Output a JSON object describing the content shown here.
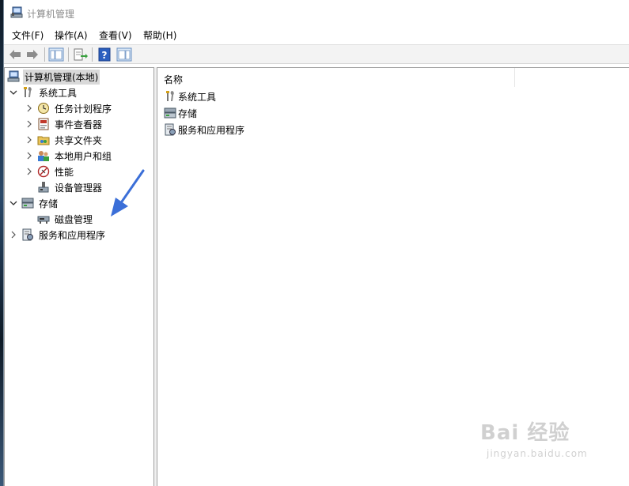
{
  "window": {
    "title": "计算机管理"
  },
  "menu": [
    {
      "label": "文件(F)"
    },
    {
      "label": "操作(A)"
    },
    {
      "label": "查看(V)"
    },
    {
      "label": "帮助(H)"
    }
  ],
  "tree": {
    "root": "计算机管理(本地)",
    "system_tools": "系统工具",
    "task_scheduler": "任务计划程序",
    "event_viewer": "事件查看器",
    "shared_folders": "共享文件夹",
    "local_users_groups": "本地用户和组",
    "performance": "性能",
    "device_manager": "设备管理器",
    "storage": "存储",
    "disk_management": "磁盘管理",
    "services_apps": "服务和应用程序"
  },
  "list": {
    "column_name": "名称",
    "items": [
      "系统工具",
      "存储",
      "服务和应用程序"
    ]
  },
  "watermark": {
    "main": "Bai  经验",
    "sub": "jingyan.baidu.com"
  },
  "colors": {
    "accent_arrow": "#3b6fd8",
    "selection": "#d9d9d9"
  }
}
